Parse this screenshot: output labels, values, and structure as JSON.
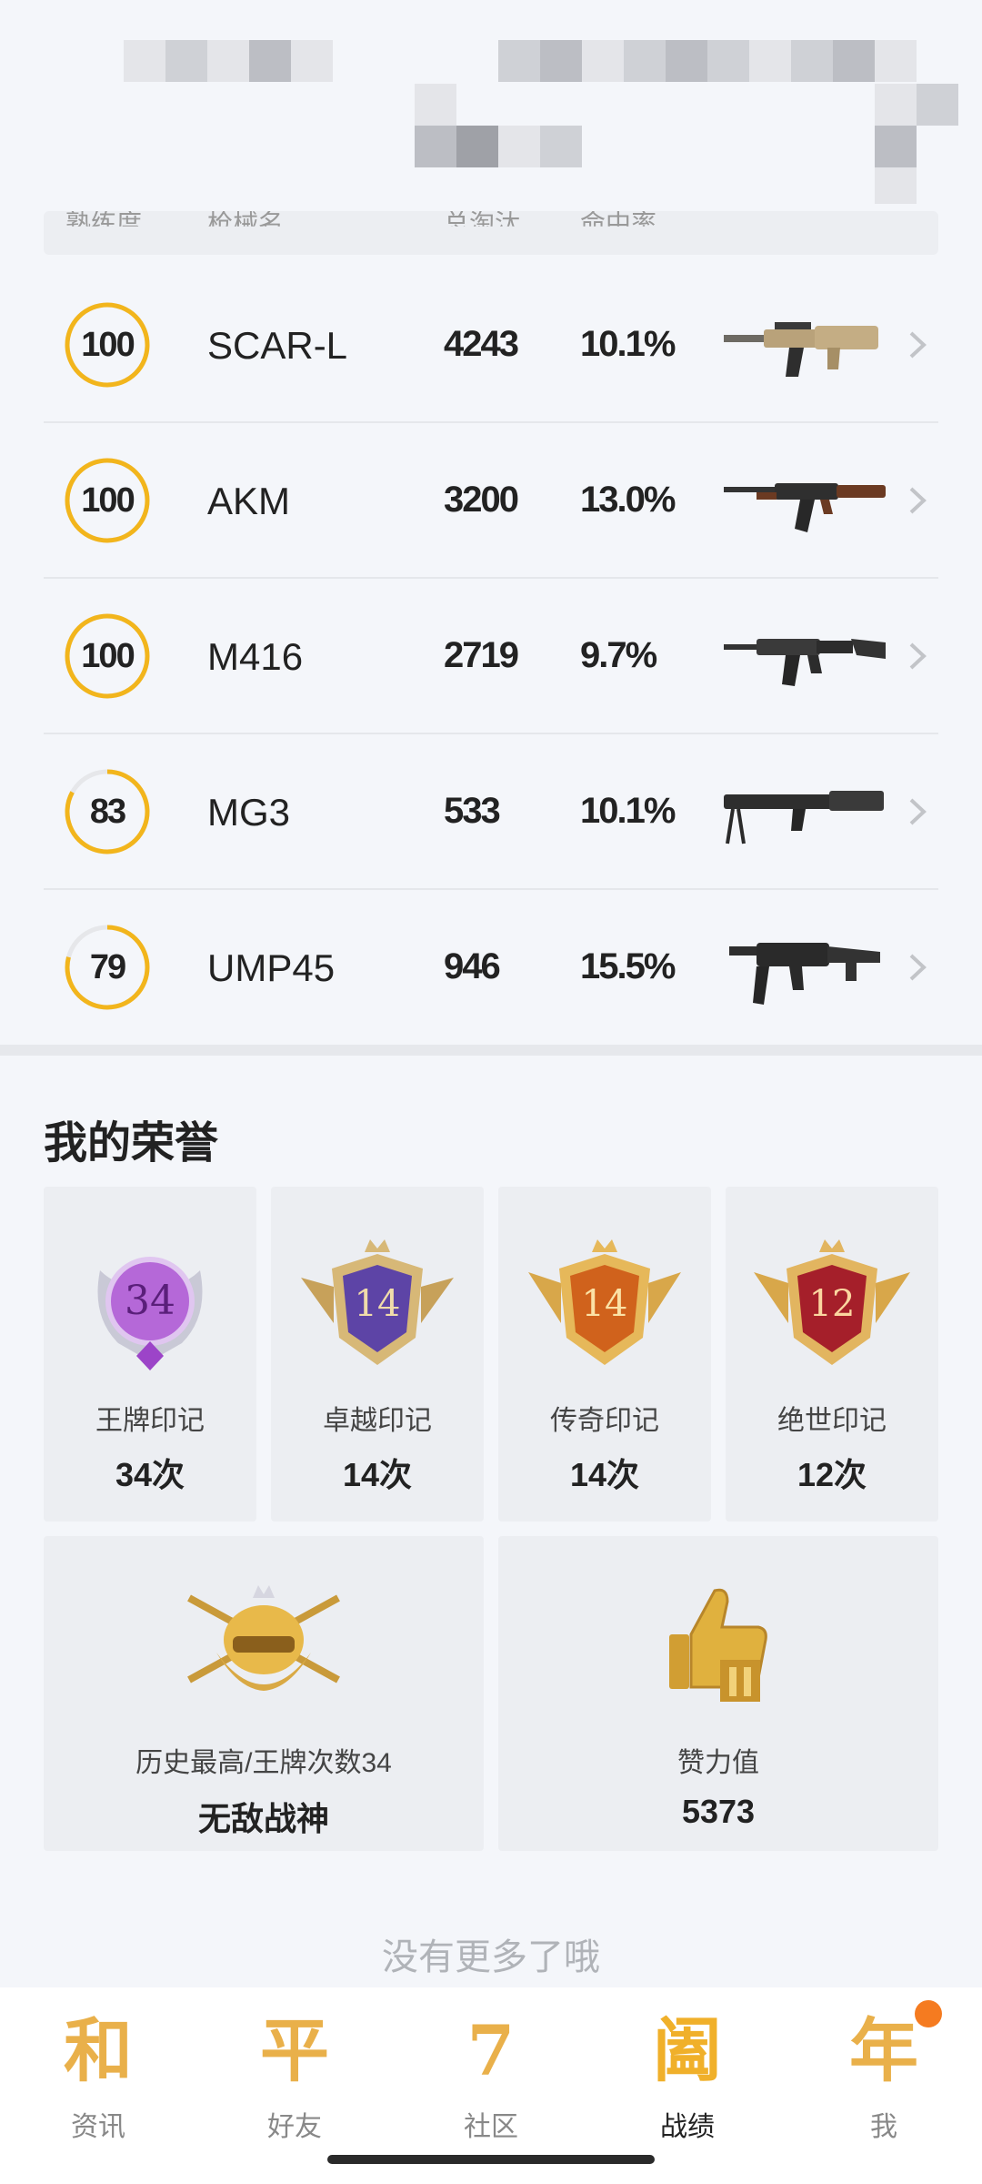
{
  "table": {
    "headers": [
      "熟练度",
      "枪械名",
      "总淘汰",
      "命中率"
    ],
    "rows": [
      {
        "mastery": 100,
        "name": "SCAR-L",
        "kills": "4243",
        "rate": "10.1%"
      },
      {
        "mastery": 100,
        "name": "AKM",
        "kills": "3200",
        "rate": "13.0%"
      },
      {
        "mastery": 100,
        "name": "M416",
        "kills": "2719",
        "rate": "9.7%"
      },
      {
        "mastery": 83,
        "name": "MG3",
        "kills": "533",
        "rate": "10.1%"
      },
      {
        "mastery": 79,
        "name": "UMP45",
        "kills": "946",
        "rate": "15.5%"
      }
    ]
  },
  "honors": {
    "title": "我的荣誉",
    "marks": [
      {
        "badge": "34",
        "label": "王牌印记",
        "count": "34次",
        "tone": "purple"
      },
      {
        "badge": "14",
        "label": "卓越印记",
        "count": "14次",
        "tone": "violet"
      },
      {
        "badge": "14",
        "label": "传奇印记",
        "count": "14次",
        "tone": "orange"
      },
      {
        "badge": "12",
        "label": "绝世印记",
        "count": "12次",
        "tone": "red"
      }
    ],
    "highest": {
      "label": "历史最高/王牌次数34",
      "value": "无敌战神"
    },
    "likes": {
      "label": "赞力值",
      "value": "5373"
    }
  },
  "footer_note": "没有更多了哦",
  "nav": {
    "items": [
      {
        "glyph": "和",
        "label": "资讯"
      },
      {
        "glyph": "平",
        "label": "好友"
      },
      {
        "glyph": "7",
        "label": "社区"
      },
      {
        "glyph": "阖",
        "label": "战绩"
      },
      {
        "glyph": "年",
        "label": "我"
      }
    ],
    "active_index": 3
  },
  "colors": {
    "ring": "#f2b51c",
    "ring_track": "#e6e7ea",
    "accent": "#e9b04a",
    "notify_dot": "#f57b20"
  }
}
